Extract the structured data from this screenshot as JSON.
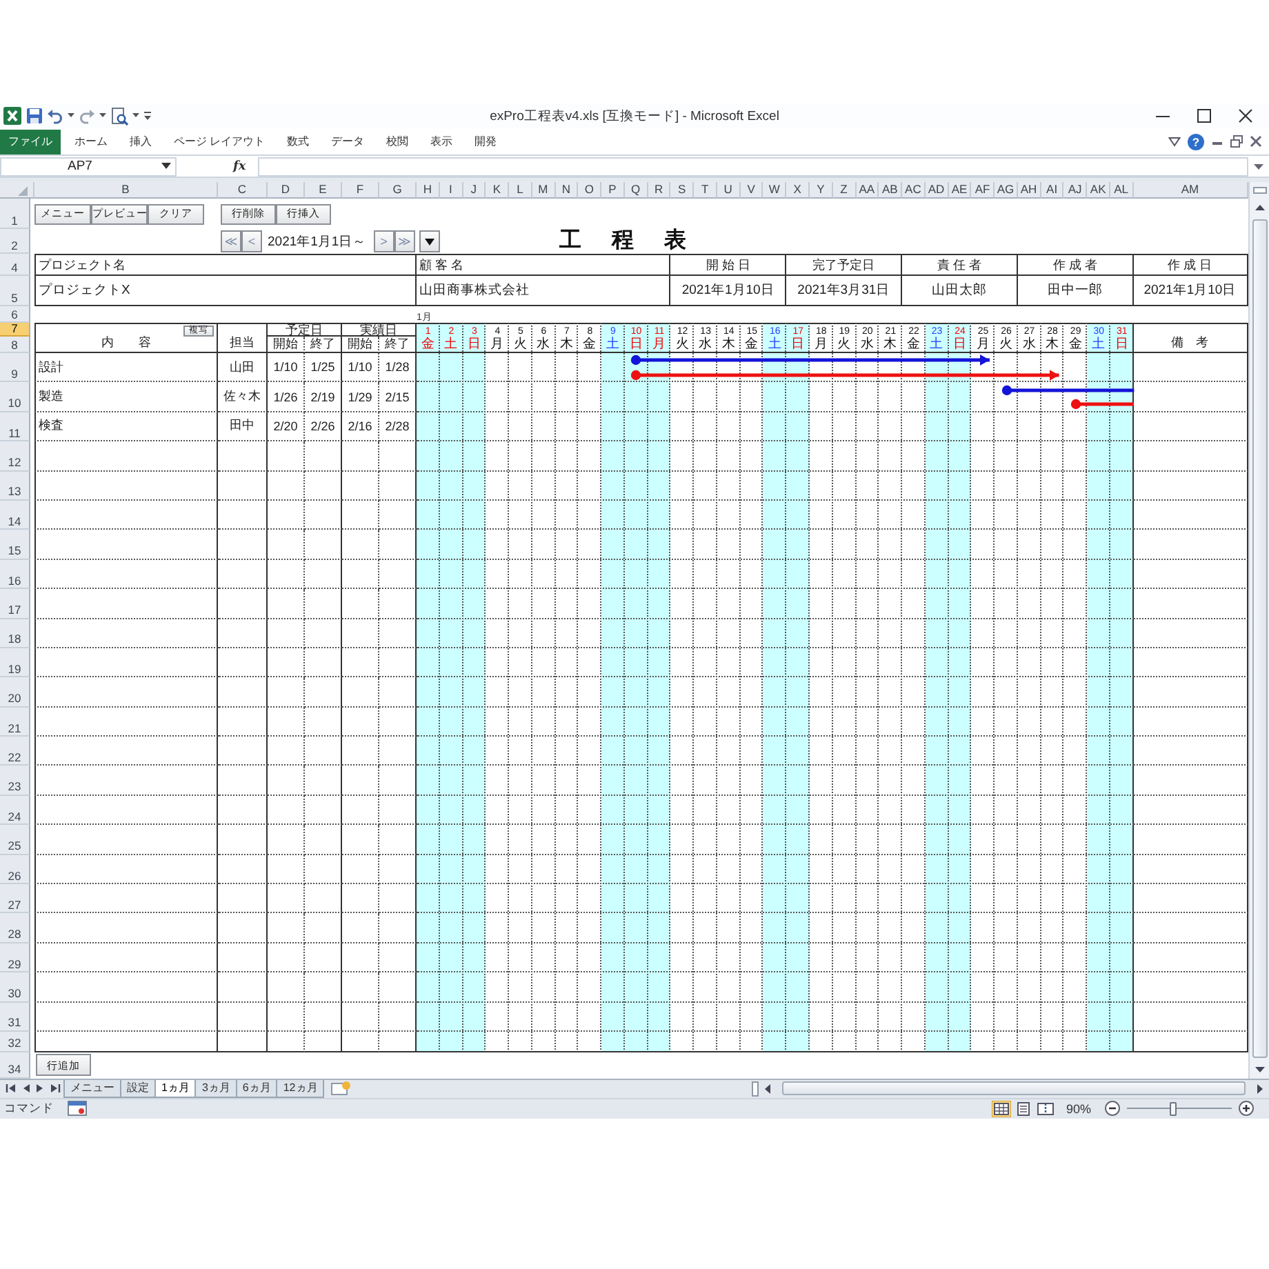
{
  "window": {
    "title": "exPro工程表v4.xls [互換モード] - Microsoft Excel"
  },
  "ribbon": {
    "tabs": [
      {
        "label": "ファイル",
        "kind": "file"
      },
      {
        "label": "ホーム",
        "kind": "tab"
      },
      {
        "label": "挿入",
        "kind": "tab"
      },
      {
        "label": "ページ レイアウト",
        "kind": "tab"
      },
      {
        "label": "数式",
        "kind": "tab"
      },
      {
        "label": "データ",
        "kind": "tab"
      },
      {
        "label": "校閲",
        "kind": "tab"
      },
      {
        "label": "表示",
        "kind": "tab"
      },
      {
        "label": "開発",
        "kind": "tab"
      }
    ],
    "help": "?"
  },
  "formula_bar": {
    "name_box": "AP7",
    "function_label": "fx"
  },
  "sheet": {
    "column_headers": [
      "B",
      "C",
      "D",
      "E",
      "F",
      "G",
      "H",
      "I",
      "J",
      "K",
      "L",
      "M",
      "N",
      "O",
      "P",
      "Q",
      "R",
      "S",
      "T",
      "U",
      "V",
      "W",
      "X",
      "Y",
      "Z",
      "AA",
      "AB",
      "AC",
      "AD",
      "AE",
      "AF",
      "AG",
      "AH",
      "AI",
      "AJ",
      "AK",
      "AL",
      "AM"
    ],
    "row_headers": [
      {
        "label": "1",
        "selected": false
      },
      {
        "label": "2",
        "selected": false
      },
      {
        "label": "4",
        "selected": false
      },
      {
        "label": "5",
        "selected": false
      },
      {
        "label": "6",
        "selected": false
      },
      {
        "label": "7",
        "selected": true
      },
      {
        "label": "8",
        "selected": false
      },
      {
        "label": "9",
        "selected": false
      },
      {
        "label": "10",
        "selected": false
      },
      {
        "label": "11",
        "selected": false
      },
      {
        "label": "12",
        "selected": false
      },
      {
        "label": "13",
        "selected": false
      },
      {
        "label": "14",
        "selected": false
      },
      {
        "label": "15",
        "selected": false
      },
      {
        "label": "16",
        "selected": false
      },
      {
        "label": "17",
        "selected": false
      },
      {
        "label": "18",
        "selected": false
      },
      {
        "label": "19",
        "selected": false
      },
      {
        "label": "20",
        "selected": false
      },
      {
        "label": "21",
        "selected": false
      },
      {
        "label": "22",
        "selected": false
      },
      {
        "label": "23",
        "selected": false
      },
      {
        "label": "24",
        "selected": false
      },
      {
        "label": "25",
        "selected": false
      },
      {
        "label": "26",
        "selected": false
      },
      {
        "label": "27",
        "selected": false
      },
      {
        "label": "28",
        "selected": false
      },
      {
        "label": "29",
        "selected": false
      },
      {
        "label": "30",
        "selected": false
      },
      {
        "label": "31",
        "selected": false
      },
      {
        "label": "32",
        "selected": false
      },
      {
        "label": "34",
        "selected": false
      }
    ],
    "toolbar": {
      "sheet_buttons": [
        "メニュー",
        "プレビュー",
        "クリア"
      ],
      "row_buttons": [
        "行削除",
        "行挿入"
      ]
    },
    "navigation": {
      "back_buttons": [
        "≪",
        "<"
      ],
      "date_range": "2021年1月1日～",
      "forward_buttons": [
        ">",
        "≫"
      ]
    },
    "title": "工　程　表",
    "info": [
      {
        "label": "プロジェクト名",
        "value": "プロジェクトX"
      },
      {
        "label": "顧 客 名",
        "value": "山田商事株式会社"
      },
      {
        "label": "開 始 日",
        "value": "2021年1月10日"
      },
      {
        "label": "完了予定日",
        "value": "2021年3月31日"
      },
      {
        "label": "責 任 者",
        "value": "山田太郎"
      },
      {
        "label": "作 成 者",
        "value": "田中一郎"
      },
      {
        "label": "作 成 日",
        "value": "2021年1月10日"
      }
    ],
    "month_label": "1月",
    "table_header": {
      "content": "内　　容",
      "copy_button": "複写",
      "assignee": "担当",
      "planned": "予定日",
      "actual": "実績日",
      "planned_start": "開始",
      "planned_end": "終了",
      "actual_start": "開始",
      "actual_end": "終了",
      "remarks": "備　考"
    },
    "days": [
      {
        "day": "1",
        "weekday": "金",
        "kind": "holiday"
      },
      {
        "day": "2",
        "weekday": "土",
        "kind": "holiday"
      },
      {
        "day": "3",
        "weekday": "日",
        "kind": "holiday"
      },
      {
        "day": "4",
        "weekday": "月",
        "kind": "weekday"
      },
      {
        "day": "5",
        "weekday": "火",
        "kind": "weekday"
      },
      {
        "day": "6",
        "weekday": "水",
        "kind": "weekday"
      },
      {
        "day": "7",
        "weekday": "木",
        "kind": "weekday"
      },
      {
        "day": "8",
        "weekday": "金",
        "kind": "weekday"
      },
      {
        "day": "9",
        "weekday": "土",
        "kind": "saturday"
      },
      {
        "day": "10",
        "weekday": "日",
        "kind": "holiday"
      },
      {
        "day": "11",
        "weekday": "月",
        "kind": "holiday"
      },
      {
        "day": "12",
        "weekday": "火",
        "kind": "weekday"
      },
      {
        "day": "13",
        "weekday": "水",
        "kind": "weekday"
      },
      {
        "day": "14",
        "weekday": "木",
        "kind": "weekday"
      },
      {
        "day": "15",
        "weekday": "金",
        "kind": "weekday"
      },
      {
        "day": "16",
        "weekday": "土",
        "kind": "saturday"
      },
      {
        "day": "17",
        "weekday": "日",
        "kind": "holiday"
      },
      {
        "day": "18",
        "weekday": "月",
        "kind": "weekday"
      },
      {
        "day": "19",
        "weekday": "火",
        "kind": "weekday"
      },
      {
        "day": "20",
        "weekday": "水",
        "kind": "weekday"
      },
      {
        "day": "21",
        "weekday": "木",
        "kind": "weekday"
      },
      {
        "day": "22",
        "weekday": "金",
        "kind": "weekday"
      },
      {
        "day": "23",
        "weekday": "土",
        "kind": "saturday"
      },
      {
        "day": "24",
        "weekday": "日",
        "kind": "holiday"
      },
      {
        "day": "25",
        "weekday": "月",
        "kind": "weekday"
      },
      {
        "day": "26",
        "weekday": "火",
        "kind": "weekday"
      },
      {
        "day": "27",
        "weekday": "水",
        "kind": "weekday"
      },
      {
        "day": "28",
        "weekday": "木",
        "kind": "weekday"
      },
      {
        "day": "29",
        "weekday": "金",
        "kind": "weekday"
      },
      {
        "day": "30",
        "weekday": "土",
        "kind": "saturday"
      },
      {
        "day": "31",
        "weekday": "日",
        "kind": "holiday"
      }
    ],
    "tasks": [
      {
        "content": "設計",
        "assignee": "山田",
        "planned_start": "1/10",
        "planned_end": "1/25",
        "actual_start": "1/10",
        "actual_end": "1/28"
      },
      {
        "content": "製造",
        "assignee": "佐々木",
        "planned_start": "1/26",
        "planned_end": "2/19",
        "actual_start": "1/29",
        "actual_end": "2/15"
      },
      {
        "content": "検査",
        "assignee": "田中",
        "planned_start": "2/20",
        "planned_end": "2/26",
        "actual_start": "2/16",
        "actual_end": "2/28"
      }
    ],
    "add_row_button": "行追加"
  },
  "sheet_tabs": [
    {
      "label": "メニュー",
      "selected": false
    },
    {
      "label": "設定",
      "selected": false
    },
    {
      "label": "1ヵ月",
      "selected": true
    },
    {
      "label": "3ヵ月",
      "selected": false
    },
    {
      "label": "6ヵ月",
      "selected": false
    },
    {
      "label": "12ヵ月",
      "selected": false
    }
  ],
  "status_bar": {
    "mode": "コマンド",
    "views": [
      {
        "kind": "normal",
        "selected": true
      },
      {
        "kind": "page_layout",
        "selected": false
      },
      {
        "kind": "page_break",
        "selected": false
      }
    ],
    "zoom": "90%",
    "zoom_slider": {
      "level": 0.44
    }
  }
}
